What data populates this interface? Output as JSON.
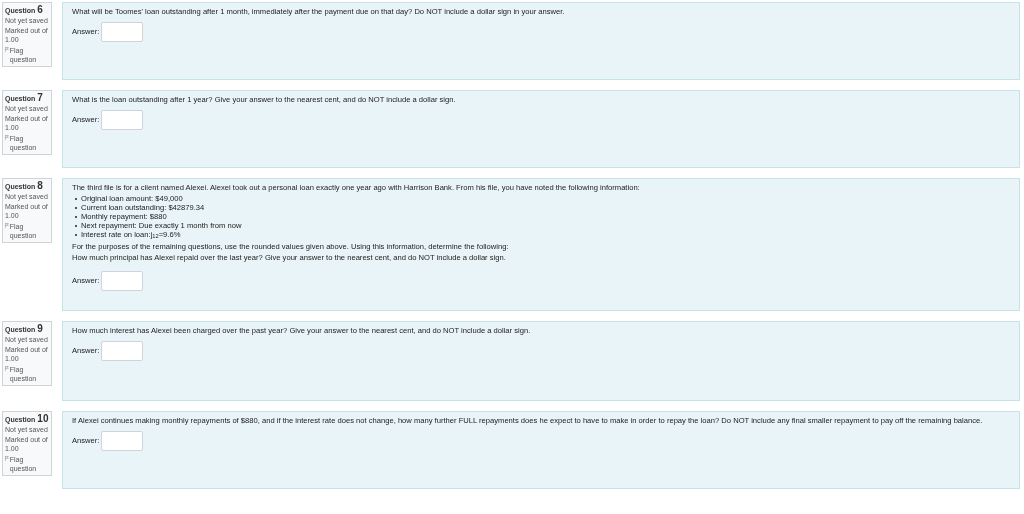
{
  "questions": [
    {
      "label": "Question",
      "number": "6",
      "status": "Not yet saved",
      "marks": "Marked out of 1.00",
      "flag": "Flag question",
      "text": [
        "What will be Toomes' loan outstanding after 1 month, immediately after the payment due on that day? Do NOT include a dollar sign in your answer."
      ],
      "answer_label": "Answer:"
    },
    {
      "label": "Question",
      "number": "7",
      "status": "Not yet saved",
      "marks": "Marked out of 1.00",
      "flag": "Flag question",
      "text": [
        "What is the loan outstanding after 1 year? Give your answer to the nearest cent, and do NOT include a dollar sign."
      ],
      "answer_label": "Answer:"
    },
    {
      "label": "Question",
      "number": "8",
      "status": "Not yet saved",
      "marks": "Marked out of 1.00",
      "flag": "Flag question",
      "intro": "The third file is for a client named Alexei. Alexei took out a personal loan exactly one year ago with Harrison Bank. From his file, you have noted the following information:",
      "bullets": [
        "Original loan amount: $49,000",
        "Current loan outstanding: $42879.34",
        "Monthly repayment: $880",
        "Next repayment: Due exactly 1 month from now",
        "Interest rate on loan:j$_{12}$=9.6%"
      ],
      "text": [
        "For the purposes of the remaining questions, use the rounded values given above. Using this information, determine the following:",
        "How much principal has Alexei repaid over the last year? Give your answer to the nearest cent, and do NOT include a dollar sign."
      ],
      "answer_label": "Answer:"
    },
    {
      "label": "Question",
      "number": "9",
      "status": "Not yet saved",
      "marks": "Marked out of 1.00",
      "flag": "Flag question",
      "text": [
        "How much interest has Alexei been charged over the past year? Give your answer to the nearest cent, and do NOT include a dollar sign."
      ],
      "answer_label": "Answer:"
    },
    {
      "label": "Question",
      "number": "10",
      "status": "Not yet saved",
      "marks": "Marked out of 1.00",
      "flag": "Flag question",
      "text": [
        "If Alexei continues making monthly repayments of $880, and if the interest rate does not change, how many further FULL repayments does he expect to have to make in order to repay the loan? Do NOT include any final smaller repayment to pay off the remaining balance."
      ],
      "answer_label": "Answer:"
    }
  ]
}
